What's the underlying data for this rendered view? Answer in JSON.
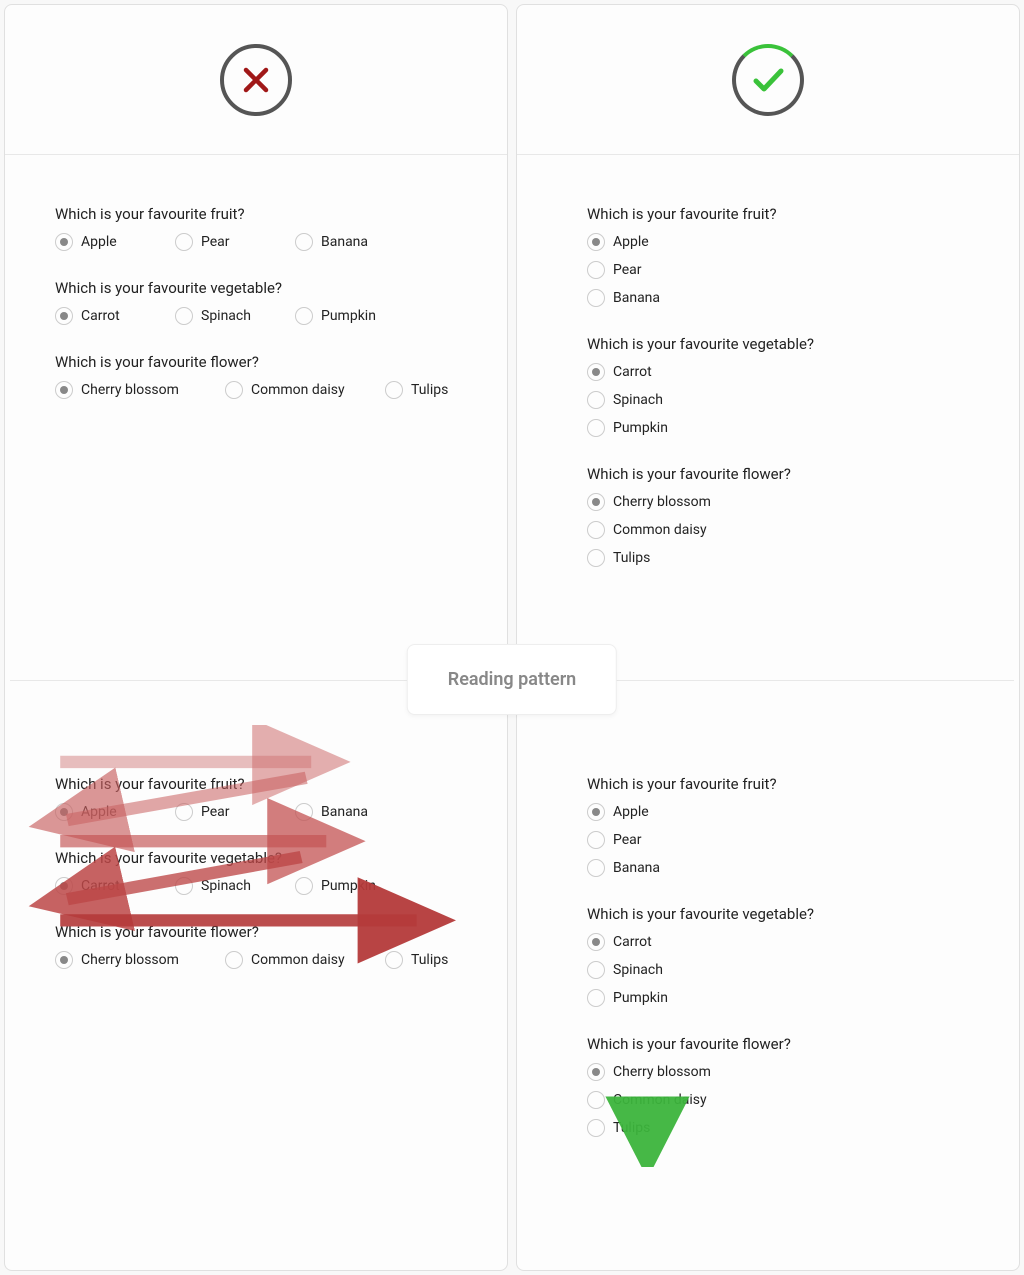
{
  "badge": "Reading pattern",
  "q1": {
    "label": "Which is your favourite fruit?",
    "opts": [
      "Apple",
      "Pear",
      "Banana"
    ],
    "sel": 0
  },
  "q2": {
    "label": "Which is your favourite vegetable?",
    "opts": [
      "Carrot",
      "Spinach",
      "Pumpkin"
    ],
    "sel": 0
  },
  "q3": {
    "label": "Which is your favourite flower?",
    "opts": [
      "Cherry blossom",
      "Common daisy",
      "Tulips"
    ],
    "sel": 0
  }
}
